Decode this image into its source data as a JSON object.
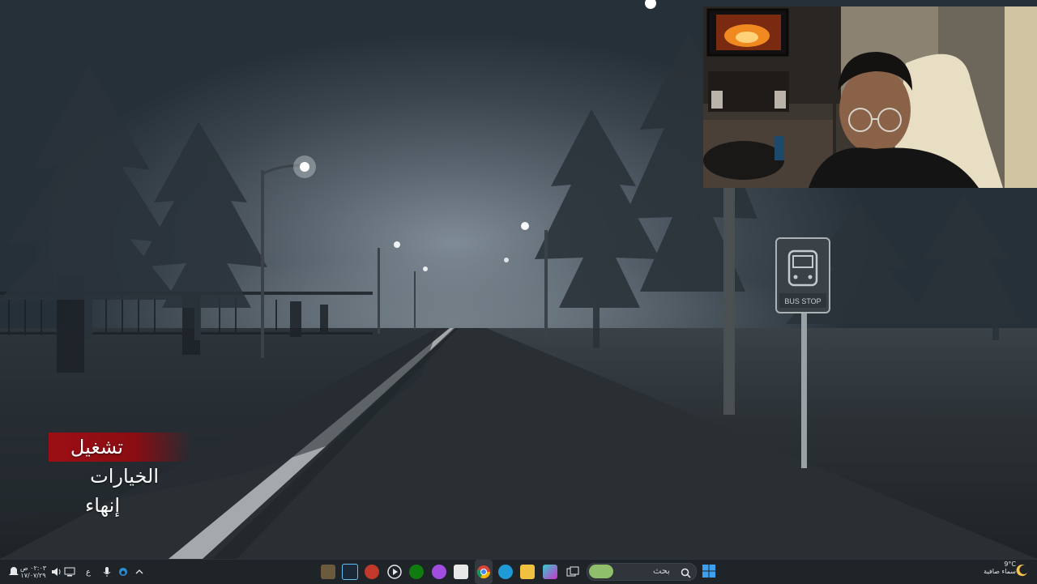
{
  "game_menu": {
    "items": [
      {
        "label": "تشغيل",
        "selected": true
      },
      {
        "label": "الخيارات",
        "selected": false
      },
      {
        "label": "إنهاء",
        "selected": false
      }
    ]
  },
  "scene": {
    "sign_text": "BUS STOP"
  },
  "taskbar": {
    "search_placeholder": "بحث",
    "weather_temp": "9°C",
    "weather_desc": "سماء صافية",
    "clock_time": "٠٢:٠٣ ص",
    "clock_date": "١٧/٠٧/٢٩",
    "language": "ع",
    "pinned_apps": [
      "game-app-icon",
      "steam-icon",
      "media-app-icon",
      "play-icon",
      "xbox-icon",
      "messenger-icon",
      "store-icon",
      "chrome-icon",
      "edge-icon",
      "file-explorer-icon",
      "photos-app-icon",
      "task-view-icon"
    ]
  },
  "colors": {
    "menu_highlight": "#9b0f14",
    "taskbar_bg": "#1f2429"
  }
}
